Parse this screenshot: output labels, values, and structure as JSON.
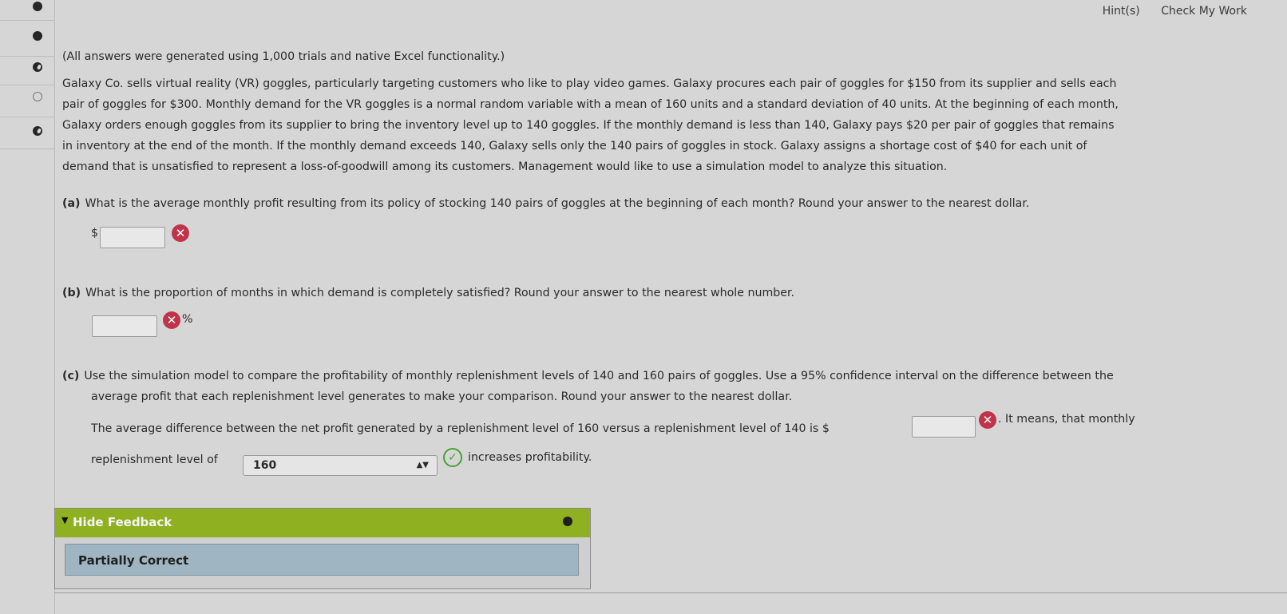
{
  "header": {
    "hints": "Hint(s)",
    "check": "Check My Work"
  },
  "intro": "(All answers were generated using 1,000 trials and native Excel functionality.)",
  "problem_lines": [
    "Galaxy Co. sells virtual reality (VR) goggles, particularly targeting customers who like to play video games. Galaxy procures each pair of goggles for $150 from its supplier and sells each",
    "pair of goggles for $300. Monthly demand for the VR goggles is a normal random variable with a mean of 160 units and a standard deviation of 40 units. At the beginning of each month,",
    "Galaxy orders enough goggles from its supplier to bring the inventory level up to 140 goggles. If the monthly demand is less than 140, Galaxy pays $20 per pair of goggles that remains",
    "in inventory at the end of the month. If the monthly demand exceeds 140, Galaxy sells only the 140 pairs of goggles in stock. Galaxy assigns a shortage cost of $40 for each unit of",
    "demand that is unsatisfied to represent a loss-of-goodwill among its customers. Management would like to use a simulation model to analyze this situation."
  ],
  "part_a": {
    "label": "(a)",
    "question": "What is the average monthly profit resulting from its policy of stocking 140 pairs of goggles at the beginning of each month? Round your answer to the nearest dollar.",
    "prefix": "$",
    "value": "",
    "status": "incorrect"
  },
  "part_b": {
    "label": "(b)",
    "question": "What is the proportion of months in which demand is completely satisfied? Round your answer to the nearest whole number.",
    "value": "",
    "suffix": "%",
    "status": "incorrect"
  },
  "part_c": {
    "label": "(c)",
    "question_line1": "Use the simulation model to compare the profitability of monthly replenishment levels of 140 and 160 pairs of goggles. Use a 95% confidence interval on the difference between the",
    "question_line2": "average profit that each replenishment level generates to make your comparison. Round your answer to the nearest dollar.",
    "sentence_start": "The average difference between the net profit generated by a replenishment level of 160 versus a replenishment level of 140 is $",
    "value": "",
    "sentence_mid": ". It means, that monthly",
    "sentence_line2_start": "replenishment level of",
    "select_value": "160",
    "sentence_end": "increases profitability."
  },
  "feedback": {
    "toggle_label": "Hide Feedback",
    "status": "Partially Correct"
  },
  "colors": {
    "incorrect": "#c0344a",
    "correct": "#49a234",
    "feedback_header": "#8fb020",
    "feedback_box": "#9fb5c2"
  }
}
